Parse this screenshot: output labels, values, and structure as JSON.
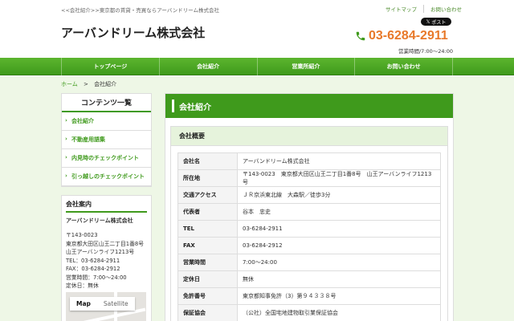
{
  "header": {
    "tagline": "<<会社紹介>>東京都の賃貸・売買ならアーバンドリーム株式会社",
    "toplinks": [
      "サイトマップ",
      "お問い合わせ"
    ],
    "post_label": "ポスト",
    "logo": "アーバンドリーム株式会社",
    "phone": "03-6284-2911",
    "hours": "営業時間/7:00～24:00"
  },
  "nav": [
    "トップページ",
    "会社紹介",
    "営業所紹介",
    "お問い合わせ"
  ],
  "breadcrumb": {
    "home": "ホーム",
    "sep": ">",
    "current": "会社紹介"
  },
  "sidebar": {
    "contents_title": "コンテンツ一覧",
    "items": [
      "会社紹介",
      "不動産用語集",
      "内見時のチェックポイント",
      "引っ越しのチェックポイント"
    ],
    "info_title": "会社案内",
    "company": "アーバンドリーム株式会社",
    "lines": [
      "〒143-0023",
      "東京都大田区山王二丁目1番8号",
      "山王アーバンライフ1213号",
      "TEL：03-6284-2911",
      "FAX：03-6284-2912",
      "営業時間：7:00～24:00",
      "定休日：無休"
    ],
    "map_buttons": [
      "Map",
      "Satellite"
    ]
  },
  "main": {
    "title": "会社紹介",
    "section_title": "会社概要",
    "rows": [
      {
        "k": "会社名",
        "v": "アーバンドリーム株式会社"
      },
      {
        "k": "所在地",
        "v": "〒143-0023　東京都大田区山王二丁目1番8号　山王アーバンライフ1213号"
      },
      {
        "k": "交通アクセス",
        "v": "ＪＲ京浜東北線　大森駅／徒歩3分"
      },
      {
        "k": "代表者",
        "v": "谷本　忠史"
      },
      {
        "k": "TEL",
        "v": "03-6284-2911"
      },
      {
        "k": "FAX",
        "v": "03-6284-2912"
      },
      {
        "k": "営業時間",
        "v": "7:00～24:00"
      },
      {
        "k": "定休日",
        "v": "無休"
      },
      {
        "k": "免許番号",
        "v": "東京都知事免許（3）第９４３３８号"
      },
      {
        "k": "保証協会",
        "v": "（公社）全国宅地建物取引業保証協会"
      }
    ]
  }
}
